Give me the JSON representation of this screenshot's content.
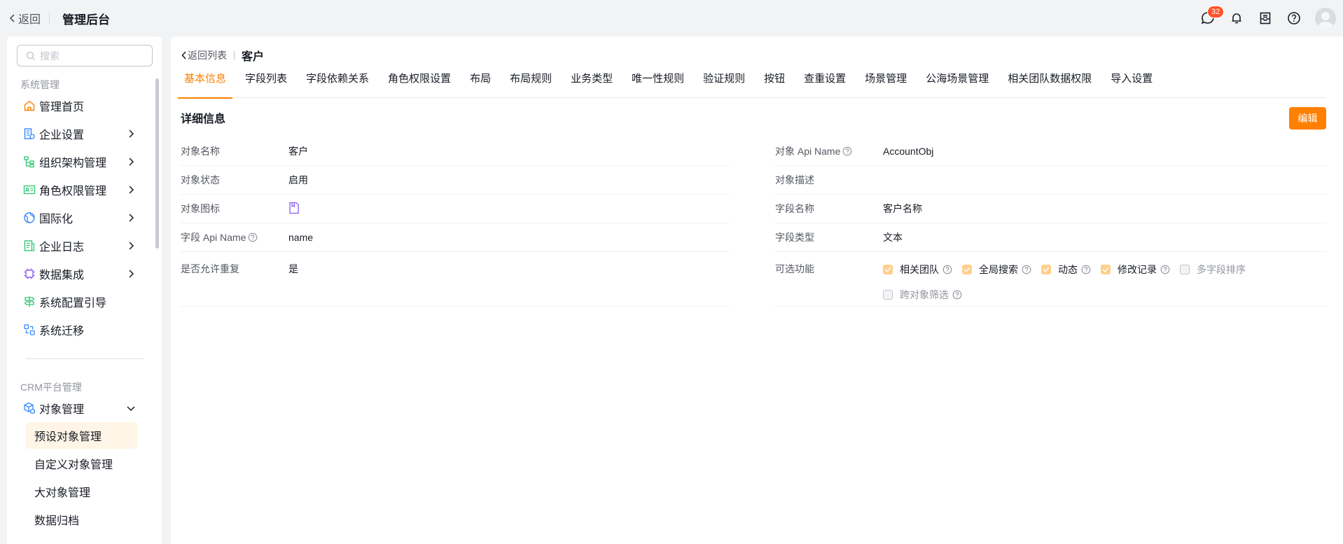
{
  "topbar": {
    "back_label": "返回",
    "title": "管理后台",
    "message_badge": "32",
    "icons": [
      "message-icon",
      "bell-icon",
      "inbox-icon",
      "help-icon",
      "avatar"
    ]
  },
  "sidebar": {
    "search_placeholder": "搜索",
    "section1_title": "系统管理",
    "items": [
      {
        "label": "管理首页",
        "icon": "home-icon",
        "has_children": false
      },
      {
        "label": "企业设置",
        "icon": "company-icon",
        "has_children": true
      },
      {
        "label": "组织架构管理",
        "icon": "org-icon",
        "has_children": true
      },
      {
        "label": "角色权限管理",
        "icon": "role-icon",
        "has_children": true
      },
      {
        "label": "国际化",
        "icon": "globe-icon",
        "has_children": true
      },
      {
        "label": "企业日志",
        "icon": "log-icon",
        "has_children": true
      },
      {
        "label": "数据集成",
        "icon": "chip-icon",
        "has_children": true
      },
      {
        "label": "系统配置引导",
        "icon": "guide-icon",
        "has_children": false
      },
      {
        "label": "系统迁移",
        "icon": "migrate-icon",
        "has_children": false
      }
    ],
    "section2_title": "CRM平台管理",
    "crm_item": {
      "label": "对象管理",
      "icon": "object-icon",
      "expanded": true
    },
    "sub_items": [
      {
        "label": "预设对象管理",
        "active": true
      },
      {
        "label": "自定义对象管理",
        "active": false
      },
      {
        "label": "大对象管理",
        "active": false
      },
      {
        "label": "数据归档",
        "active": false
      }
    ]
  },
  "main": {
    "breadcrumb_back": "返回列表",
    "page_title": "客户",
    "tabs": [
      "基本信息",
      "字段列表",
      "字段依赖关系",
      "角色权限设置",
      "布局",
      "布局规则",
      "业务类型",
      "唯一性规则",
      "验证规则",
      "按钮",
      "查重设置",
      "场景管理",
      "公海场景管理",
      "相关团队数据权限",
      "导入设置"
    ],
    "active_tab": 0,
    "section_title": "详细信息",
    "edit_label": "编辑",
    "left_fields": [
      {
        "label": "对象名称",
        "value": "客户",
        "help": false
      },
      {
        "label": "对象状态",
        "value": "启用",
        "help": false
      },
      {
        "label": "对象图标",
        "value": "",
        "help": false,
        "icon": "object-doc-icon"
      },
      {
        "label": "字段 Api Name",
        "value": "name",
        "help": true
      },
      {
        "label": "是否允许重复",
        "value": "是",
        "help": false
      }
    ],
    "right_fields": [
      {
        "label": "对象 Api Name",
        "value": "AccountObj",
        "help": true
      },
      {
        "label": "对象描述",
        "value": "",
        "help": false
      },
      {
        "label": "字段名称",
        "value": "客户名称",
        "help": false
      },
      {
        "label": "字段类型",
        "value": "文本",
        "help": false
      }
    ],
    "options_label": "可选功能",
    "options": [
      {
        "label": "相关团队",
        "checked": true,
        "disabled": false,
        "help": true
      },
      {
        "label": "全局搜索",
        "checked": true,
        "disabled": false,
        "help": true
      },
      {
        "label": "动态",
        "checked": true,
        "disabled": false,
        "help": true
      },
      {
        "label": "修改记录",
        "checked": true,
        "disabled": false,
        "help": true
      },
      {
        "label": "多字段排序",
        "checked": false,
        "disabled": true,
        "help": false
      },
      {
        "label": "跨对象筛选",
        "checked": false,
        "disabled": true,
        "help": true
      }
    ]
  },
  "colors": {
    "accent": "#ff8000",
    "accent_light": "#fff5e6",
    "checkbox_on": "#ffcf8c",
    "badge": "#ff522a"
  }
}
